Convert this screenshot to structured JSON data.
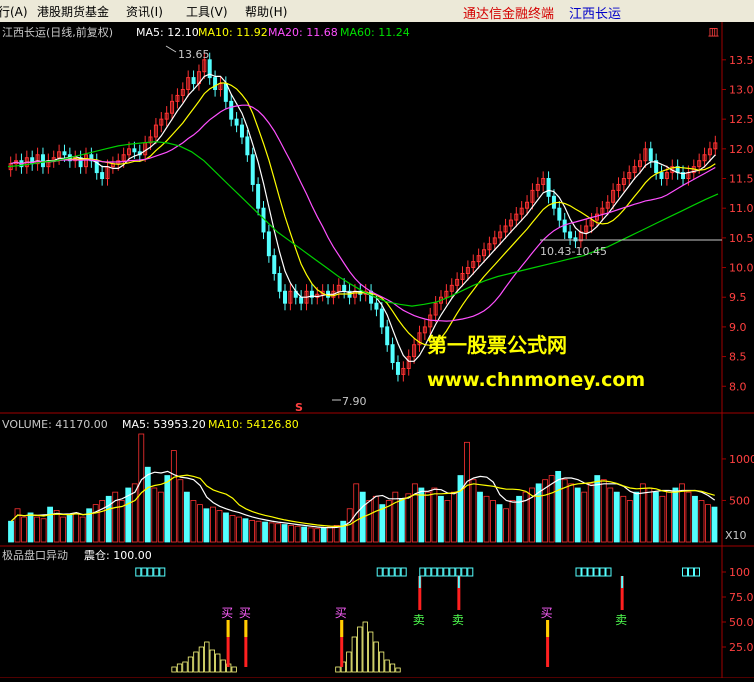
{
  "menu": {
    "items": [
      "行(A)",
      "港股期货基金",
      "资讯(I)",
      "工具(V)",
      "帮助(H)"
    ],
    "brand": "通达信金融终端",
    "stock_name": "江西长运"
  },
  "main_panel": {
    "header_stock": "江西长运(日线,前复权)",
    "ma5": "MA5: 12.10",
    "ma10": "MA10: 11.92",
    "ma20": "MA20: 11.68",
    "ma60": "MA60: 11.24",
    "corner_badge": "皿",
    "high_label": "13.65",
    "low_label": "7.90",
    "range_label": "10.43-10.45",
    "marker": "S",
    "watermark_cn": "第一股票公式网",
    "watermark_url": "www.chnmoney.com",
    "y_ticks": [
      "13.5",
      "13.0",
      "12.5",
      "12.0",
      "11.5",
      "11.0",
      "10.5",
      "10.0",
      "9.5",
      "9.0",
      "8.5",
      "8.0"
    ]
  },
  "volume_panel": {
    "header_volume": "VOLUME: 41170.00",
    "ma5": "MA5: 53953.20",
    "ma10": "MA10: 54126.80",
    "y_ticks": [
      "1000",
      "500"
    ],
    "unit": "X10"
  },
  "indicator_panel": {
    "name": "极品盘口异动",
    "value": "震仓: 100.00",
    "y_ticks": [
      "100",
      "75.0",
      "50.0",
      "25.0"
    ],
    "buy_label": "买",
    "sell_label": "卖"
  },
  "chart_data": [
    {
      "type": "candlestick",
      "title": "江西长运(日线,前复权)",
      "ylim": [
        7.6,
        13.8
      ],
      "high": 13.65,
      "low": 7.9,
      "close": [
        11.75,
        11.8,
        11.7,
        11.85,
        11.75,
        11.9,
        11.7,
        11.8,
        11.85,
        11.95,
        11.9,
        11.8,
        11.85,
        11.7,
        11.9,
        11.8,
        11.6,
        11.5,
        11.7,
        11.75,
        11.8,
        11.9,
        12.0,
        11.95,
        11.9,
        12.1,
        12.2,
        12.4,
        12.5,
        12.6,
        12.8,
        12.9,
        13.0,
        13.2,
        13.1,
        13.3,
        13.5,
        13.2,
        13.0,
        13.1,
        12.8,
        12.5,
        12.4,
        12.2,
        11.9,
        11.4,
        11.0,
        10.6,
        10.2,
        9.9,
        9.6,
        9.4,
        9.6,
        9.5,
        9.4,
        9.6,
        9.5,
        9.55,
        9.6,
        9.5,
        9.6,
        9.7,
        9.6,
        9.5,
        9.6,
        9.55,
        9.6,
        9.4,
        9.3,
        9.0,
        8.7,
        8.4,
        8.2,
        8.3,
        8.5,
        8.7,
        8.9,
        9.0,
        9.2,
        9.4,
        9.5,
        9.6,
        9.7,
        9.8,
        9.9,
        10.0,
        10.1,
        10.2,
        10.3,
        10.4,
        10.5,
        10.6,
        10.7,
        10.8,
        10.9,
        11.0,
        11.1,
        11.3,
        11.4,
        11.5,
        11.2,
        11.0,
        10.8,
        10.6,
        10.5,
        10.45,
        10.6,
        10.7,
        10.8,
        10.9,
        11.0,
        11.1,
        11.3,
        11.4,
        11.5,
        11.6,
        11.7,
        11.8,
        12.0,
        11.8,
        11.6,
        11.5,
        11.6,
        11.7,
        11.6,
        11.5,
        11.6,
        11.7,
        11.8,
        11.9,
        12.0,
        12.1
      ],
      "ma60": [
        11.7,
        11.72,
        11.75,
        11.78,
        11.8,
        11.85,
        11.9,
        11.95,
        12.0,
        12.05,
        12.08,
        12.1,
        12.12,
        12.1,
        12.05,
        11.95,
        11.8,
        11.6,
        11.4,
        11.2,
        11.0,
        10.8,
        10.6,
        10.45,
        10.3,
        10.15,
        10.0,
        9.85,
        9.72,
        9.6,
        9.5,
        9.42,
        9.38,
        9.35,
        9.38,
        9.42,
        9.5,
        9.6,
        9.7,
        9.78,
        9.85,
        9.9,
        9.95,
        10.0,
        10.05,
        10.1,
        10.15,
        10.2,
        10.28,
        10.35,
        10.45,
        10.55,
        10.65,
        10.75,
        10.85,
        10.95,
        11.05,
        11.15,
        11.24
      ]
    },
    {
      "type": "bar",
      "title": "VOLUME",
      "ylim": [
        0,
        1300
      ],
      "values": [
        250,
        400,
        300,
        350,
        300,
        280,
        420,
        380,
        300,
        320,
        350,
        300,
        400,
        450,
        500,
        550,
        600,
        500,
        650,
        700,
        1300,
        900,
        650,
        600,
        800,
        1100,
        750,
        600,
        500,
        450,
        400,
        420,
        380,
        350,
        320,
        300,
        280,
        260,
        250,
        240,
        230,
        220,
        210,
        200,
        190,
        180,
        170,
        160,
        170,
        180,
        200,
        250,
        400,
        700,
        600,
        500,
        550,
        450,
        500,
        600,
        520,
        580,
        700,
        650,
        600,
        650,
        550,
        500,
        600,
        800,
        1200,
        750,
        600,
        550,
        500,
        450,
        400,
        500,
        550,
        600,
        650,
        700,
        750,
        800,
        850,
        750,
        700,
        650,
        600,
        700,
        800,
        750,
        650,
        600,
        550,
        500,
        600,
        700,
        650,
        600,
        550,
        600,
        650,
        700,
        600,
        550,
        500,
        450,
        420
      ]
    },
    {
      "type": "bar",
      "title": "极品盘口异动",
      "ylim": [
        0,
        110
      ],
      "values": [
        0,
        0,
        0,
        0,
        0,
        0,
        0,
        0,
        0,
        0,
        0,
        0,
        0,
        0,
        0,
        0,
        0,
        0,
        0,
        0,
        0,
        0,
        0,
        0,
        0,
        0,
        0,
        0,
        0,
        0,
        5,
        8,
        10,
        15,
        20,
        25,
        30,
        22,
        18,
        12,
        8,
        5,
        0,
        0,
        0,
        0,
        0,
        0,
        0,
        0,
        0,
        0,
        0,
        0,
        0,
        0,
        0,
        0,
        0,
        0,
        5,
        10,
        20,
        35,
        45,
        50,
        40,
        30,
        20,
        12,
        8,
        4,
        0,
        0,
        0,
        0,
        0,
        0,
        0,
        0,
        0,
        0,
        0,
        0,
        0,
        0,
        0,
        0,
        0,
        0,
        0,
        0,
        0,
        0,
        0,
        0,
        0,
        0,
        0,
        0,
        0,
        0,
        0,
        0,
        0,
        0,
        0,
        0,
        0,
        0,
        0,
        0,
        0,
        0,
        0,
        0,
        0,
        0,
        0,
        0,
        0,
        0,
        0,
        0,
        0,
        0,
        0,
        0,
        0,
        0
      ],
      "buy_signals": [
        0.31,
        0.335,
        0.47,
        0.76
      ],
      "sell_signals": [
        0.58,
        0.635,
        0.865
      ]
    }
  ]
}
